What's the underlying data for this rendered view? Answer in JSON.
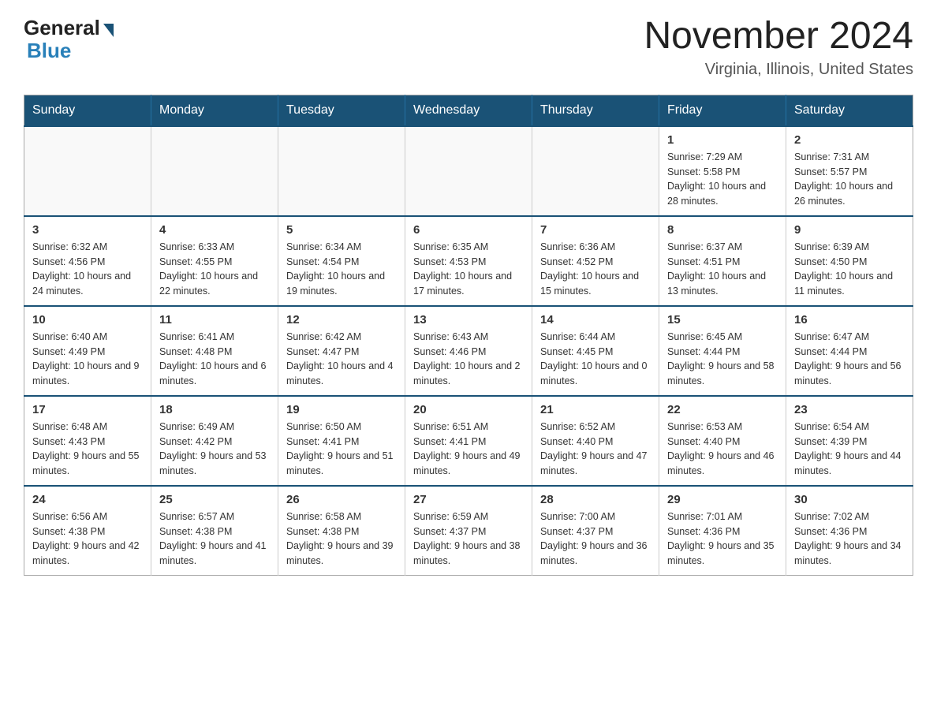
{
  "logo": {
    "general": "General",
    "blue": "Blue"
  },
  "title": "November 2024",
  "subtitle": "Virginia, Illinois, United States",
  "weekdays": [
    "Sunday",
    "Monday",
    "Tuesday",
    "Wednesday",
    "Thursday",
    "Friday",
    "Saturday"
  ],
  "weeks": [
    [
      {
        "day": "",
        "info": ""
      },
      {
        "day": "",
        "info": ""
      },
      {
        "day": "",
        "info": ""
      },
      {
        "day": "",
        "info": ""
      },
      {
        "day": "",
        "info": ""
      },
      {
        "day": "1",
        "info": "Sunrise: 7:29 AM\nSunset: 5:58 PM\nDaylight: 10 hours and 28 minutes."
      },
      {
        "day": "2",
        "info": "Sunrise: 7:31 AM\nSunset: 5:57 PM\nDaylight: 10 hours and 26 minutes."
      }
    ],
    [
      {
        "day": "3",
        "info": "Sunrise: 6:32 AM\nSunset: 4:56 PM\nDaylight: 10 hours and 24 minutes."
      },
      {
        "day": "4",
        "info": "Sunrise: 6:33 AM\nSunset: 4:55 PM\nDaylight: 10 hours and 22 minutes."
      },
      {
        "day": "5",
        "info": "Sunrise: 6:34 AM\nSunset: 4:54 PM\nDaylight: 10 hours and 19 minutes."
      },
      {
        "day": "6",
        "info": "Sunrise: 6:35 AM\nSunset: 4:53 PM\nDaylight: 10 hours and 17 minutes."
      },
      {
        "day": "7",
        "info": "Sunrise: 6:36 AM\nSunset: 4:52 PM\nDaylight: 10 hours and 15 minutes."
      },
      {
        "day": "8",
        "info": "Sunrise: 6:37 AM\nSunset: 4:51 PM\nDaylight: 10 hours and 13 minutes."
      },
      {
        "day": "9",
        "info": "Sunrise: 6:39 AM\nSunset: 4:50 PM\nDaylight: 10 hours and 11 minutes."
      }
    ],
    [
      {
        "day": "10",
        "info": "Sunrise: 6:40 AM\nSunset: 4:49 PM\nDaylight: 10 hours and 9 minutes."
      },
      {
        "day": "11",
        "info": "Sunrise: 6:41 AM\nSunset: 4:48 PM\nDaylight: 10 hours and 6 minutes."
      },
      {
        "day": "12",
        "info": "Sunrise: 6:42 AM\nSunset: 4:47 PM\nDaylight: 10 hours and 4 minutes."
      },
      {
        "day": "13",
        "info": "Sunrise: 6:43 AM\nSunset: 4:46 PM\nDaylight: 10 hours and 2 minutes."
      },
      {
        "day": "14",
        "info": "Sunrise: 6:44 AM\nSunset: 4:45 PM\nDaylight: 10 hours and 0 minutes."
      },
      {
        "day": "15",
        "info": "Sunrise: 6:45 AM\nSunset: 4:44 PM\nDaylight: 9 hours and 58 minutes."
      },
      {
        "day": "16",
        "info": "Sunrise: 6:47 AM\nSunset: 4:44 PM\nDaylight: 9 hours and 56 minutes."
      }
    ],
    [
      {
        "day": "17",
        "info": "Sunrise: 6:48 AM\nSunset: 4:43 PM\nDaylight: 9 hours and 55 minutes."
      },
      {
        "day": "18",
        "info": "Sunrise: 6:49 AM\nSunset: 4:42 PM\nDaylight: 9 hours and 53 minutes."
      },
      {
        "day": "19",
        "info": "Sunrise: 6:50 AM\nSunset: 4:41 PM\nDaylight: 9 hours and 51 minutes."
      },
      {
        "day": "20",
        "info": "Sunrise: 6:51 AM\nSunset: 4:41 PM\nDaylight: 9 hours and 49 minutes."
      },
      {
        "day": "21",
        "info": "Sunrise: 6:52 AM\nSunset: 4:40 PM\nDaylight: 9 hours and 47 minutes."
      },
      {
        "day": "22",
        "info": "Sunrise: 6:53 AM\nSunset: 4:40 PM\nDaylight: 9 hours and 46 minutes."
      },
      {
        "day": "23",
        "info": "Sunrise: 6:54 AM\nSunset: 4:39 PM\nDaylight: 9 hours and 44 minutes."
      }
    ],
    [
      {
        "day": "24",
        "info": "Sunrise: 6:56 AM\nSunset: 4:38 PM\nDaylight: 9 hours and 42 minutes."
      },
      {
        "day": "25",
        "info": "Sunrise: 6:57 AM\nSunset: 4:38 PM\nDaylight: 9 hours and 41 minutes."
      },
      {
        "day": "26",
        "info": "Sunrise: 6:58 AM\nSunset: 4:38 PM\nDaylight: 9 hours and 39 minutes."
      },
      {
        "day": "27",
        "info": "Sunrise: 6:59 AM\nSunset: 4:37 PM\nDaylight: 9 hours and 38 minutes."
      },
      {
        "day": "28",
        "info": "Sunrise: 7:00 AM\nSunset: 4:37 PM\nDaylight: 9 hours and 36 minutes."
      },
      {
        "day": "29",
        "info": "Sunrise: 7:01 AM\nSunset: 4:36 PM\nDaylight: 9 hours and 35 minutes."
      },
      {
        "day": "30",
        "info": "Sunrise: 7:02 AM\nSunset: 4:36 PM\nDaylight: 9 hours and 34 minutes."
      }
    ]
  ]
}
